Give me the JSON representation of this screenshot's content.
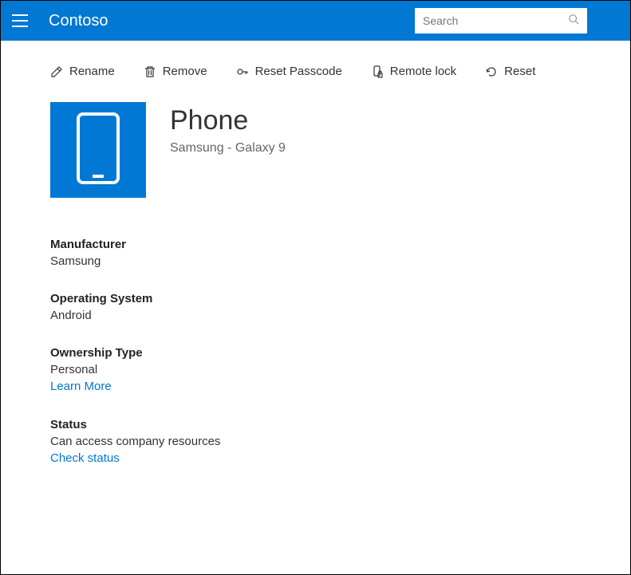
{
  "header": {
    "brand": "Contoso",
    "search_placeholder": "Search"
  },
  "toolbar": {
    "rename": "Rename",
    "remove": "Remove",
    "reset_passcode": "Reset Passcode",
    "remote_lock": "Remote lock",
    "reset": "Reset"
  },
  "device": {
    "title": "Phone",
    "subtitle": "Samsung - Galaxy 9"
  },
  "fields": {
    "manufacturer": {
      "label": "Manufacturer",
      "value": "Samsung"
    },
    "os": {
      "label": "Operating System",
      "value": "Android"
    },
    "ownership": {
      "label": "Ownership Type",
      "value": "Personal",
      "link": "Learn More"
    },
    "status": {
      "label": "Status",
      "value": "Can access company resources",
      "link": "Check status"
    }
  }
}
